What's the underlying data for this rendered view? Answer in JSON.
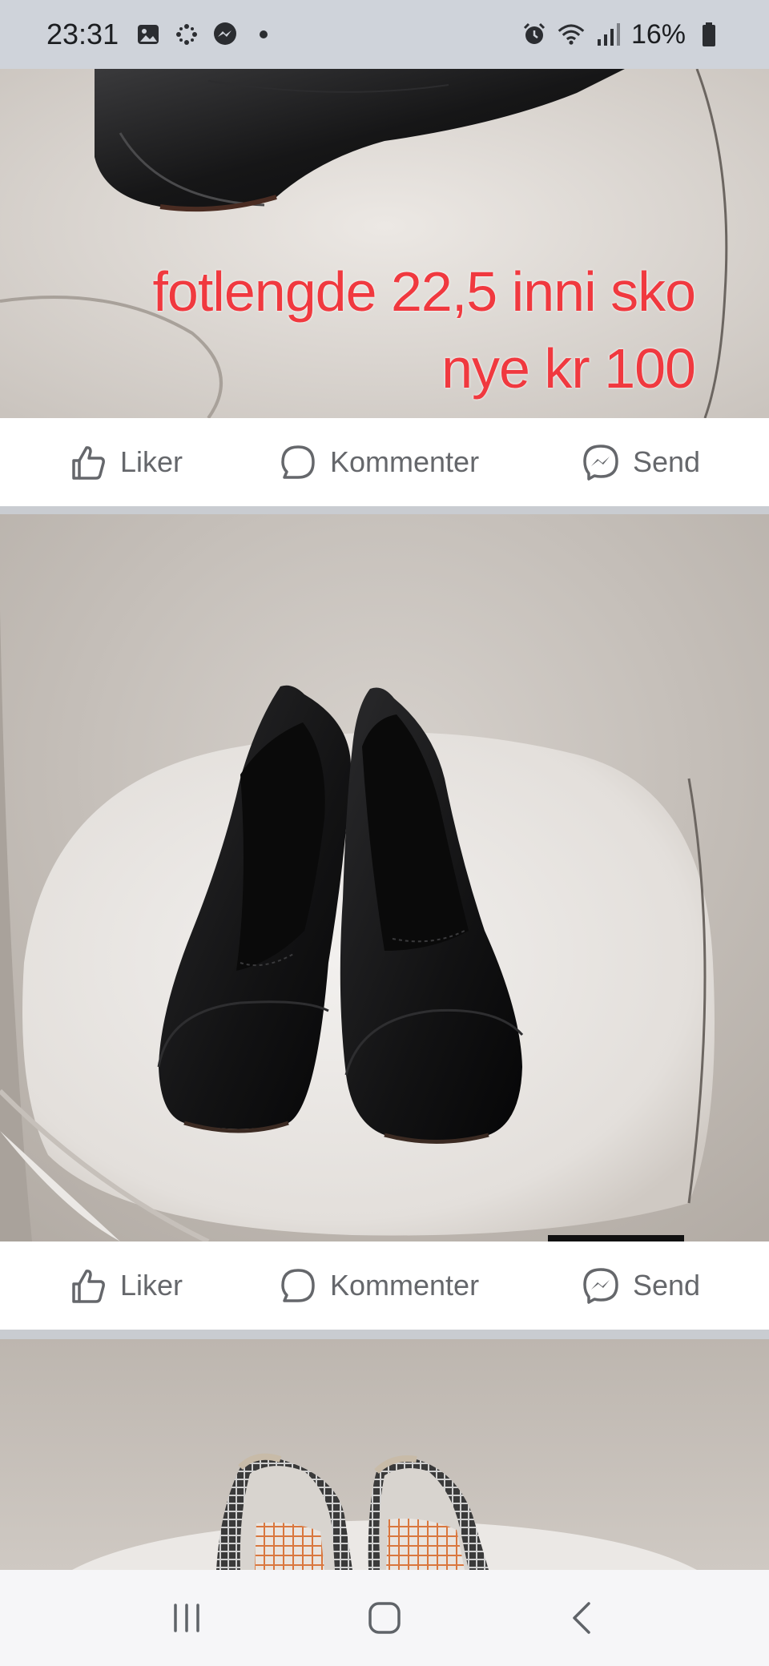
{
  "status_bar": {
    "time": "23:31",
    "battery_text": "16%",
    "icons_left": [
      "gallery-icon",
      "dots-icon",
      "messenger-icon",
      "dot-icon"
    ],
    "icons_right": [
      "alarm-icon",
      "wifi-icon",
      "signal-icon",
      "battery-icon"
    ]
  },
  "posts": [
    {
      "image": "black-flat-shoe-closeup",
      "overlay_lines": [
        "fotlengde 22,5 inni sko",
        "nye kr 100"
      ],
      "actions": {
        "like": "Liker",
        "comment": "Kommenter",
        "send": "Send"
      }
    },
    {
      "image": "pair-of-black-flat-shoes-on-white-chair",
      "actions": {
        "like": "Liker",
        "comment": "Kommenter",
        "send": "Send"
      }
    },
    {
      "image": "pair-of-patterned-shoes-partial"
    }
  ],
  "nav_bar": {
    "buttons": [
      "recent-apps-icon",
      "home-icon",
      "back-icon"
    ]
  },
  "colors": {
    "overlay_text": "#f0393f",
    "action_text": "#65676b",
    "status_bg": "#cfd3da",
    "separator": "#c9ccd1"
  }
}
